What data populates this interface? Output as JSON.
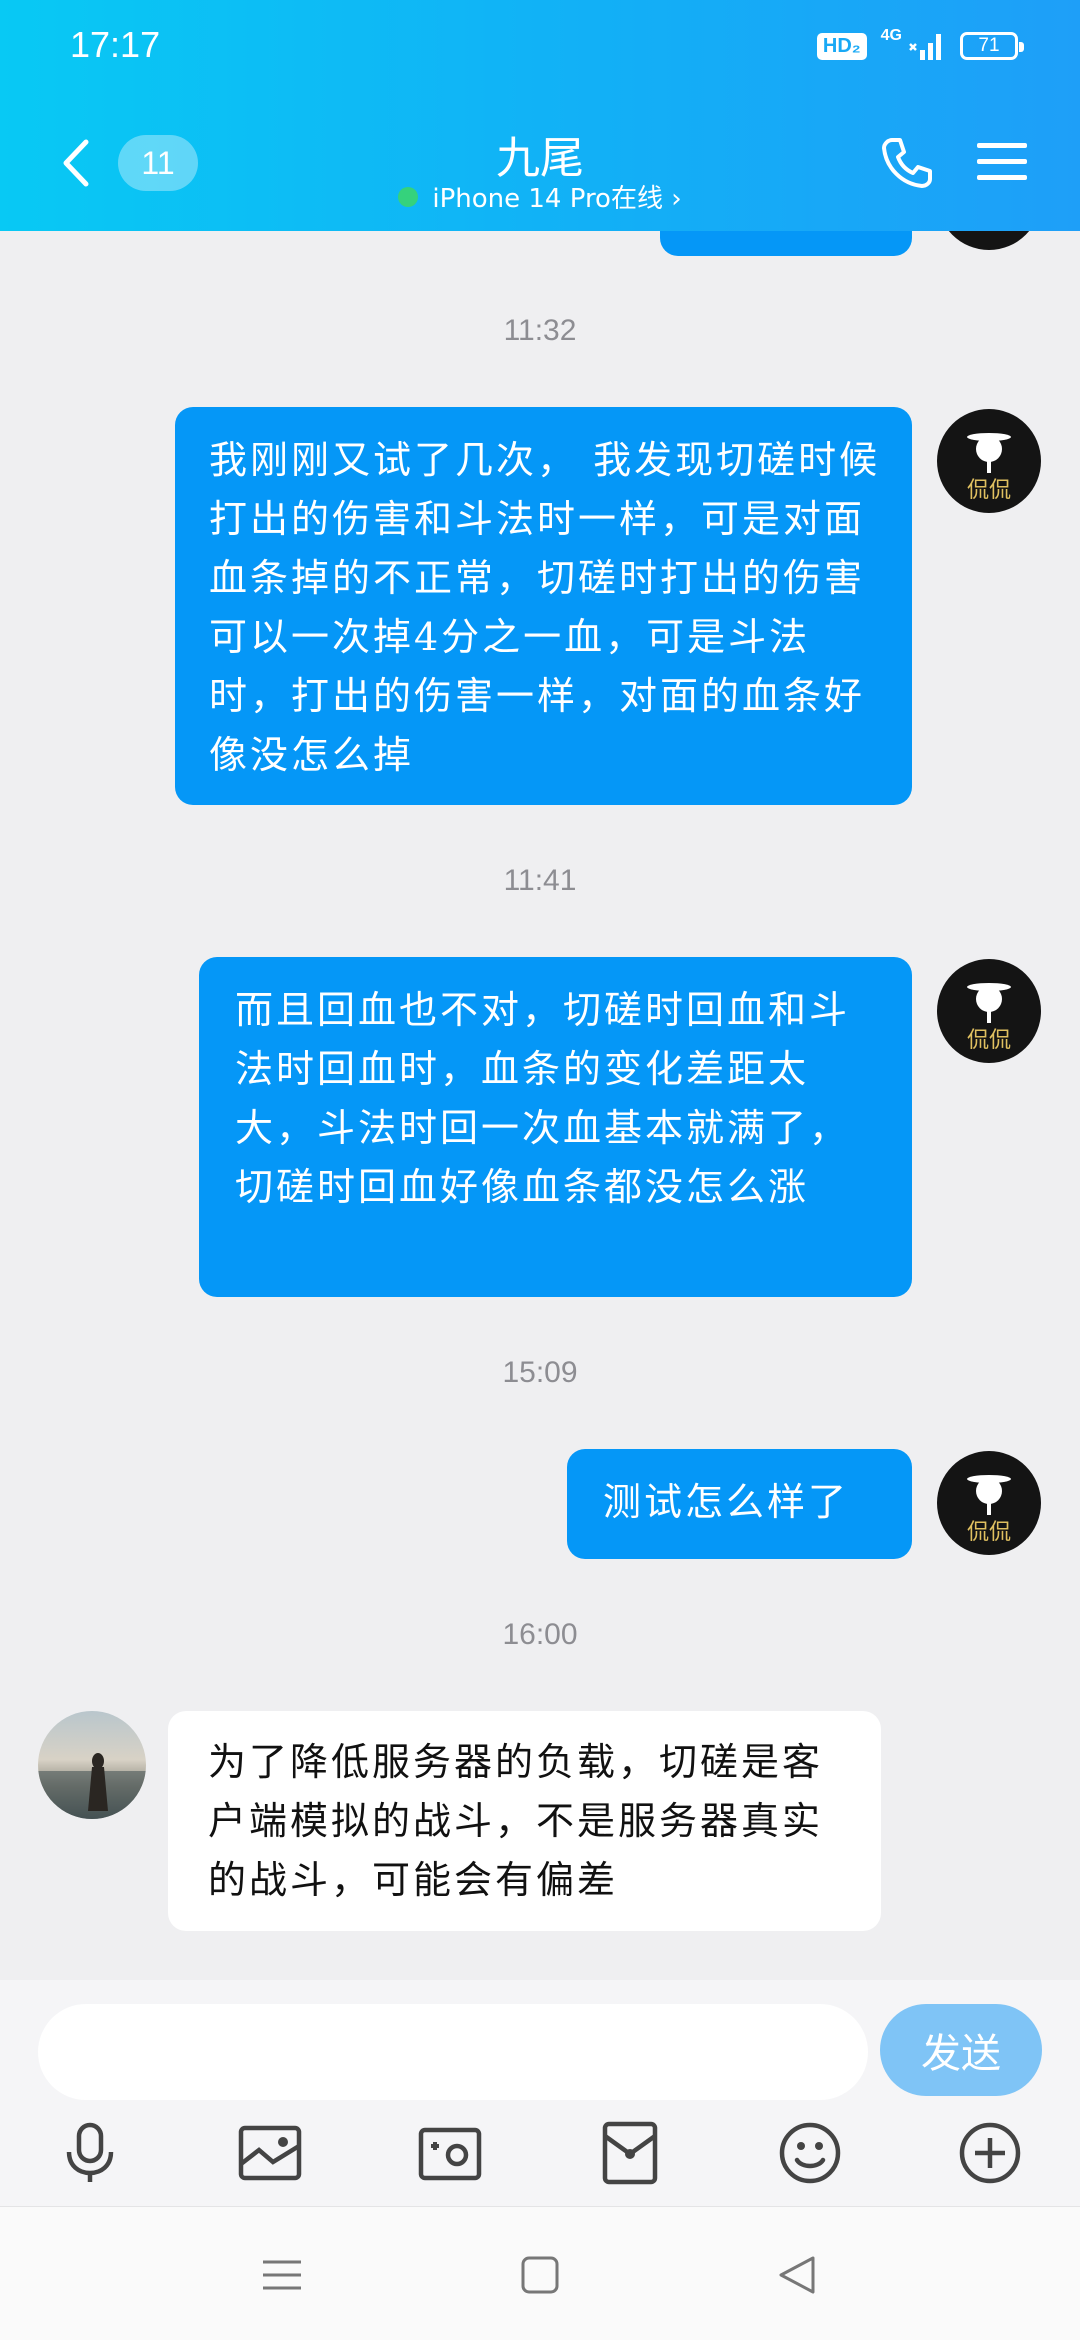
{
  "status_bar": {
    "time": "17:17",
    "hd_label": "HD₂",
    "network_label": "4G",
    "battery": "71"
  },
  "header": {
    "unread_count": "11",
    "contact_name": "九尾",
    "device_status": "iPhone 14 Pro在线 ›"
  },
  "messages": [
    {
      "time": "11:32",
      "sender": "me",
      "text": "我刚刚又试了几次， 我发现切磋时候打出的伤害和斗法时一样，可是对面血条掉的不正常，切磋时打出的伤害可以一次掉4分之一血，可是斗法时，打出的伤害一样，对面的血条好像没怎么掉"
    },
    {
      "time": "11:41",
      "sender": "me",
      "text": "而且回血也不对，切磋时回血和斗法时回血时，血条的变化差距太大，斗法时回一次血基本就满了，切磋时回血好像血条都没怎么涨"
    },
    {
      "time": "15:09",
      "sender": "me",
      "text": "测试怎么样了"
    },
    {
      "time": "16:00",
      "sender": "other",
      "text": "为了降低服务器的负载，切磋是客户端模拟的战斗，不是服务器真实的战斗，可能会有偏差"
    }
  ],
  "avatar_me_text": "侃侃",
  "input": {
    "placeholder": "",
    "send_label": "发送"
  },
  "toolbar": [
    "mic-icon",
    "image-icon",
    "camera-icon",
    "red-packet-icon",
    "emoji-icon",
    "plus-icon"
  ],
  "colors": {
    "header_gradient_start": "#08c9f4",
    "header_gradient_end": "#1e9ff8",
    "my_bubble": "#0597f7",
    "send_button": "#7fc4f6",
    "online_dot": "#35d27c"
  }
}
